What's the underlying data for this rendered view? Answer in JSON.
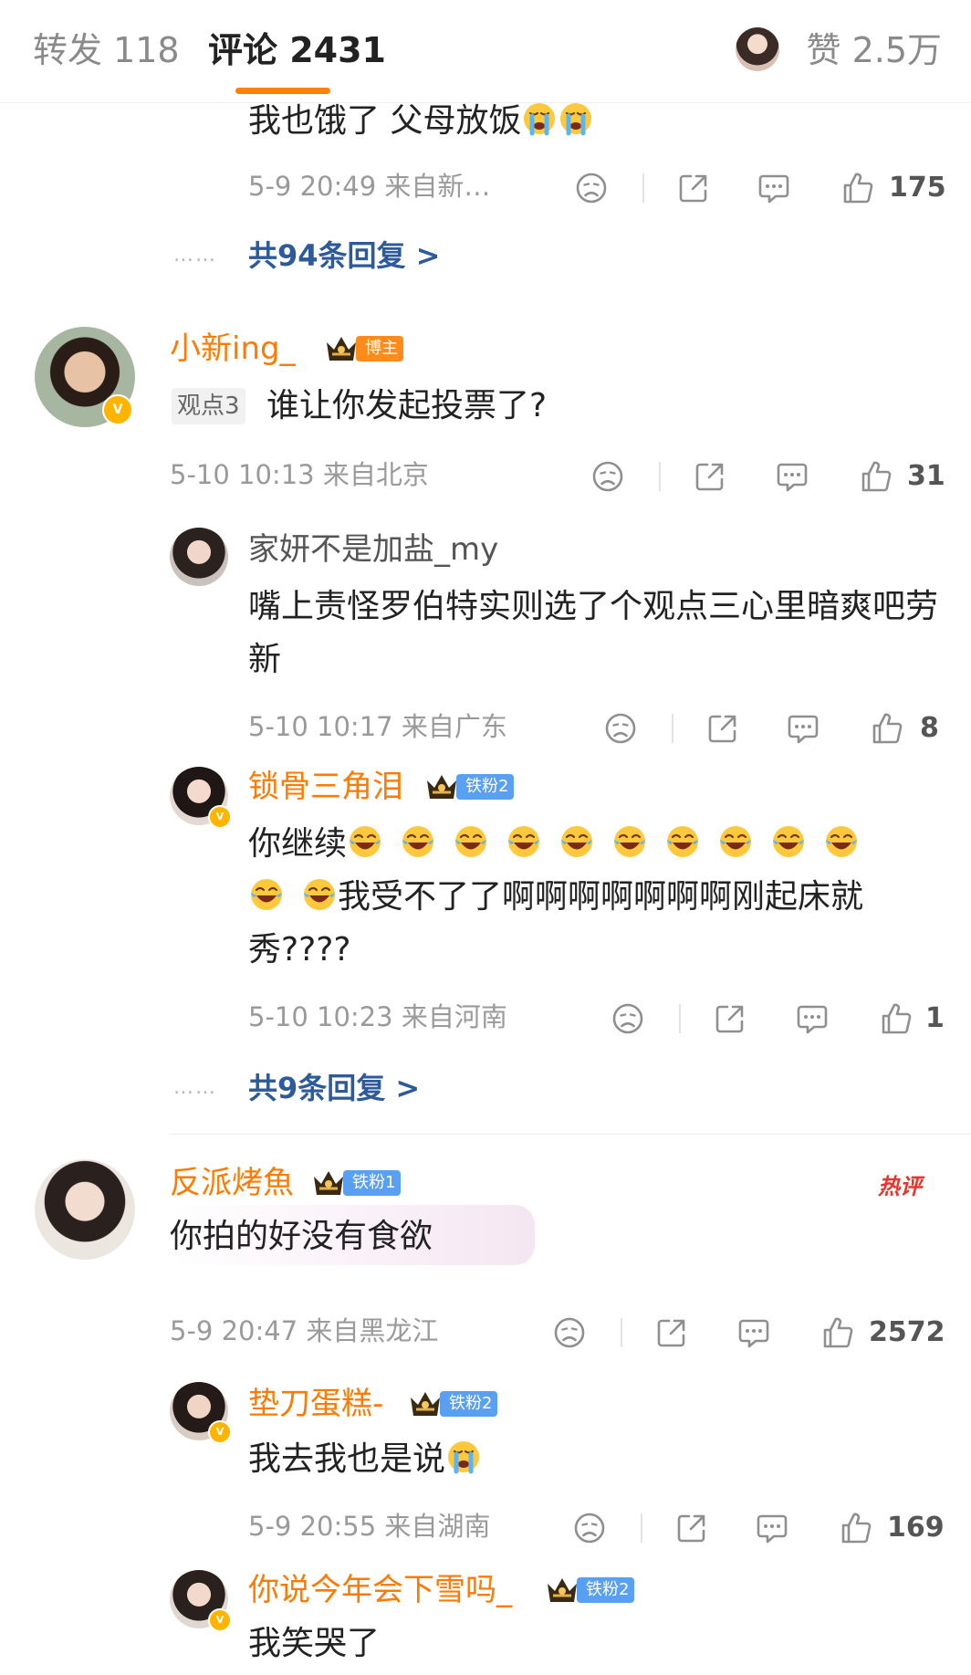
{
  "tabs": {
    "repost_label": "转发 118",
    "comments_label": "评论 2431",
    "likes_label": "赞 2.5万"
  },
  "colors": {
    "accent": "#ff8200",
    "username": "#ff7a00",
    "reply_link": "#2c5a9a",
    "fan_badge": "#5aa0f2",
    "blogger_badge": "#ff8c1a"
  },
  "icons": [
    "dislike-icon",
    "share-icon",
    "comment-icon",
    "like-icon",
    "crown-icon",
    "laugh-cry-emoji",
    "cry-emoji",
    "verified-icon"
  ],
  "comments": [
    {
      "text": "我也饿了 父母放饭",
      "emojis": [
        "cry-emoji",
        "cry-emoji"
      ],
      "meta": "5-9 20:49 来自新…",
      "likes": "175",
      "replies_link": "共94条回复 >",
      "dots": "……"
    },
    {
      "user": "小新ing_",
      "badge": "博主",
      "viewpoint": "观点3",
      "text": "谁让你发起投票了?",
      "meta": "5-10 10:13 来自北京",
      "likes": "31",
      "replies": [
        {
          "user": "家妍不是加盐_my",
          "text": "嘴上责怪罗伯特实则选了个观点三心里暗爽吧劳新",
          "meta": "5-10 10:17 来自广东",
          "likes": "8"
        },
        {
          "user": "锁骨三角泪",
          "badge": "铁粉2",
          "text_a": "你继续",
          "text_b": "我受不了了啊啊啊啊啊啊啊刚起床就秀????",
          "meta": "5-10 10:23 来自河南",
          "likes": "1"
        }
      ],
      "replies_link": "共9条回复 >",
      "dots": "……"
    },
    {
      "user": "反派烤魚",
      "badge": "铁粉1",
      "hot_label": "热评",
      "text": "你拍的好没有食欲",
      "meta": "5-9 20:47 来自黑龙江",
      "likes": "2572",
      "replies": [
        {
          "user": "垫刀蛋糕-",
          "badge": "铁粉2",
          "text": "我去我也是说",
          "meta": "5-9 20:55 来自湖南",
          "likes": "169"
        },
        {
          "user": "你说今年会下雪吗_",
          "badge": "铁粉2",
          "text": "我笑哭了"
        }
      ]
    }
  ]
}
